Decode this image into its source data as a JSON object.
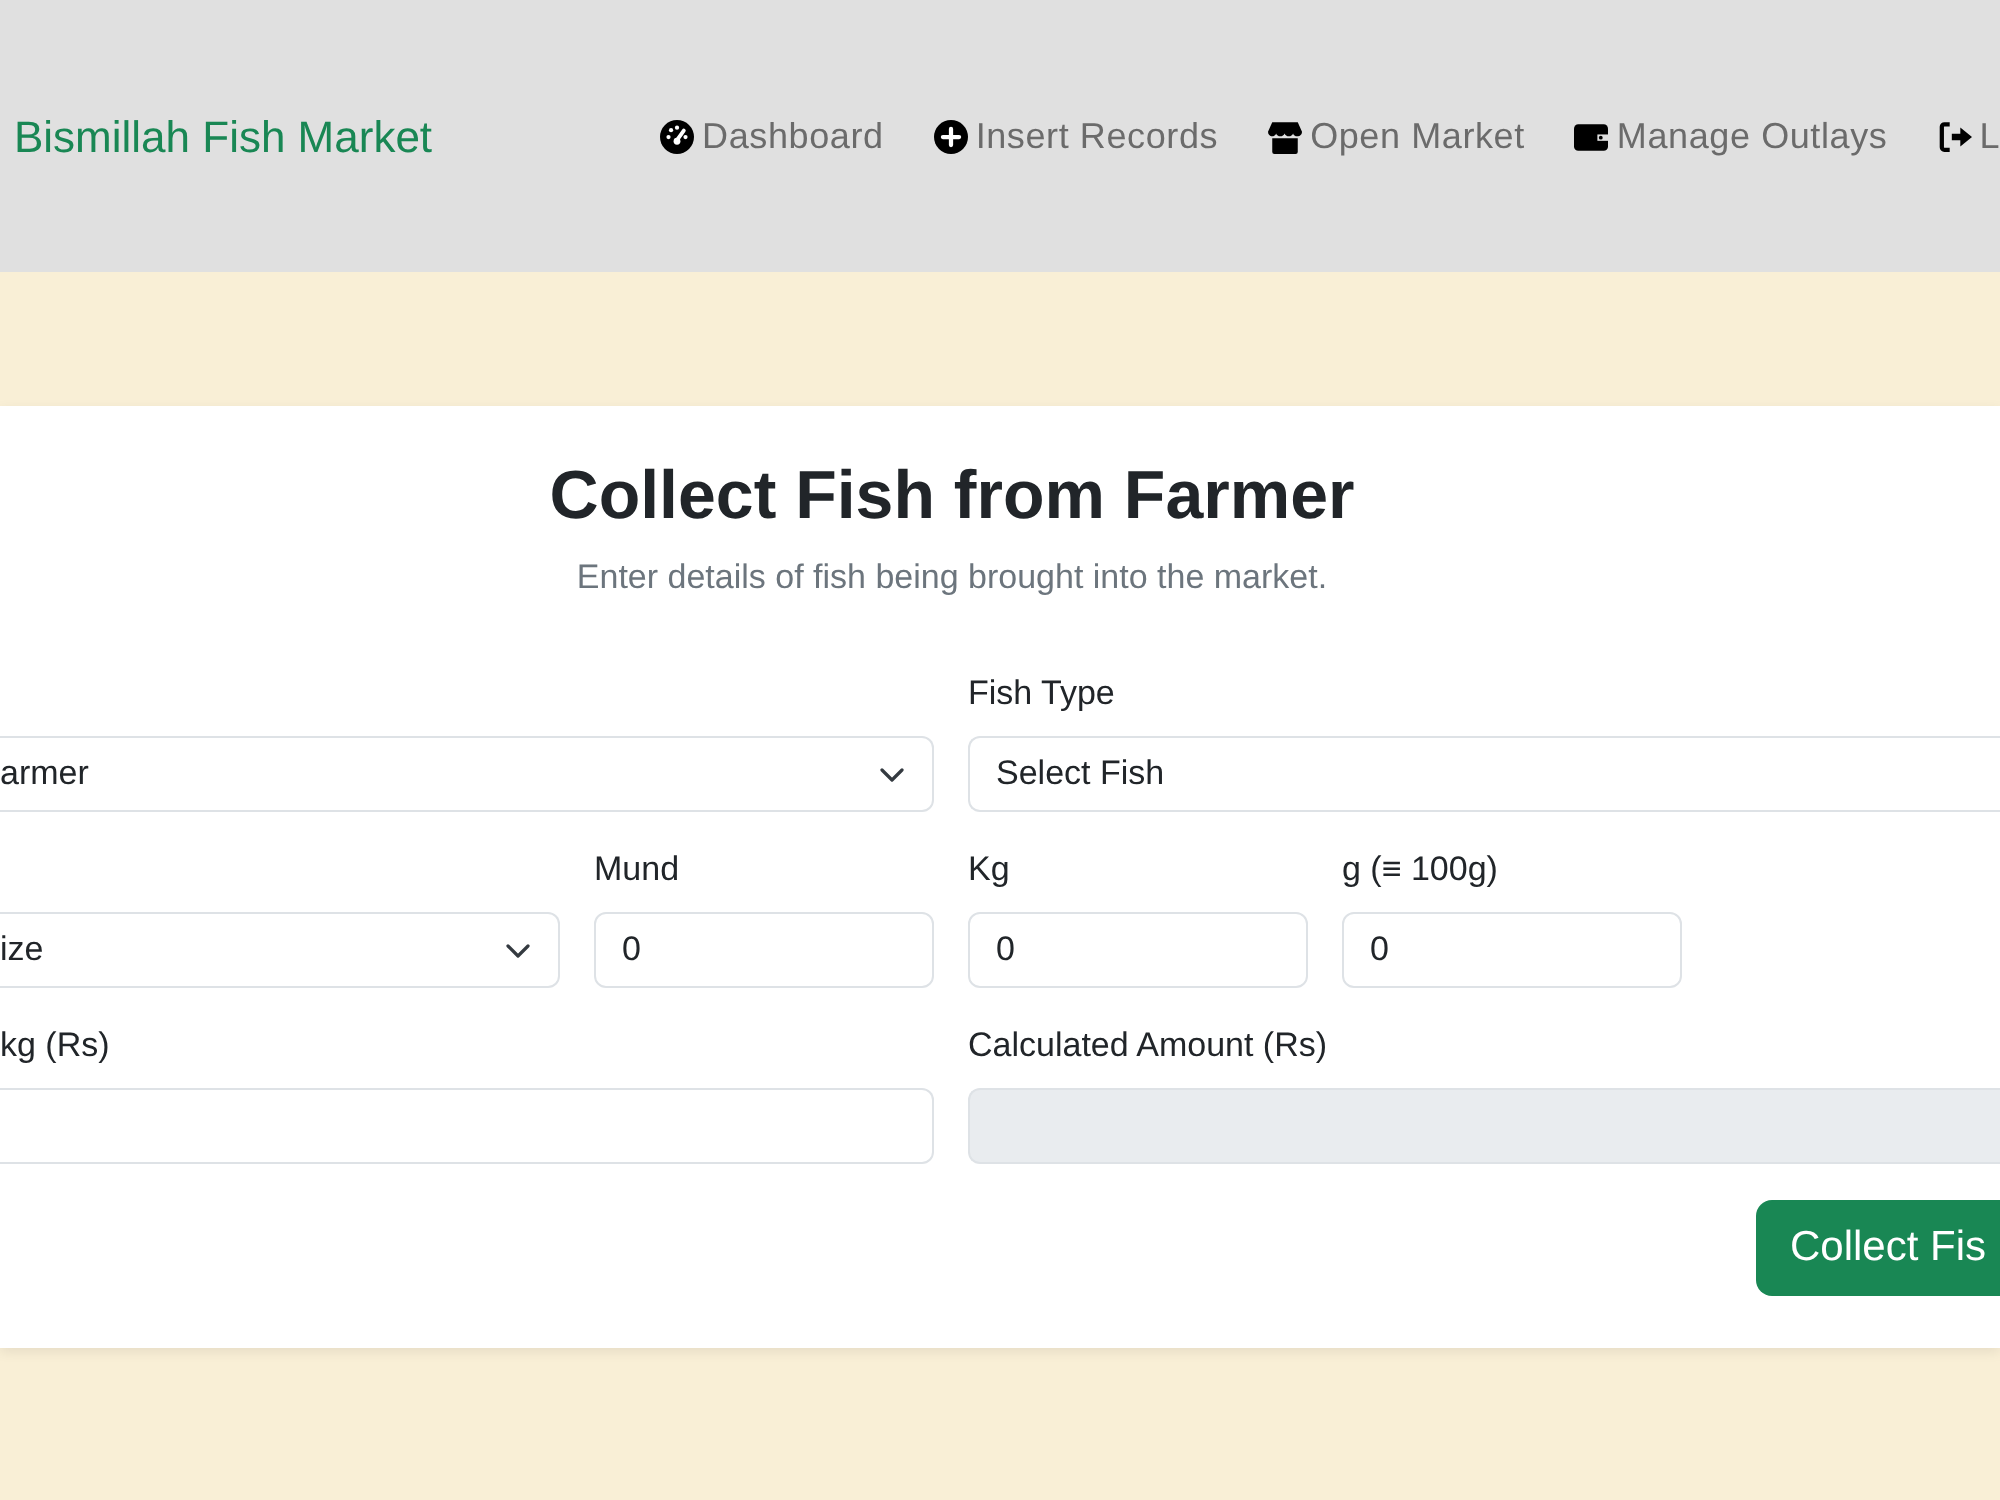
{
  "navbar": {
    "brand": "Bismillah Fish Market",
    "links": [
      {
        "label": "Dashboard"
      },
      {
        "label": "Insert Records"
      },
      {
        "label": "Open Market"
      },
      {
        "label": "Manage Outlays"
      },
      {
        "label": "L"
      }
    ]
  },
  "card": {
    "title": "Collect Fish from Farmer",
    "subtitle": "Enter details of fish being brought into the market.",
    "rows": [
      [
        {
          "kind": "select",
          "value": "armer",
          "disabled": false
        },
        {
          "kind": "select",
          "label": "Fish Type",
          "value": "Select Fish",
          "disabled": false
        }
      ],
      [
        {
          "kind": "select",
          "value": "ize",
          "disabled": false
        },
        {
          "kind": "input",
          "label": "Mund",
          "value": "0",
          "disabled": false
        },
        {
          "kind": "input",
          "label": "Kg",
          "value": "0",
          "disabled": false
        },
        {
          "kind": "input",
          "label": "g (≡ 100g)",
          "value": "0",
          "disabled": false
        }
      ],
      [
        {
          "kind": "input",
          "label": "kg (Rs)",
          "disabled": false
        },
        {
          "kind": "input",
          "label": "Calculated Amount (Rs)",
          "disabled": true
        }
      ]
    ],
    "submit": {
      "label": "Collect Fis"
    }
  }
}
